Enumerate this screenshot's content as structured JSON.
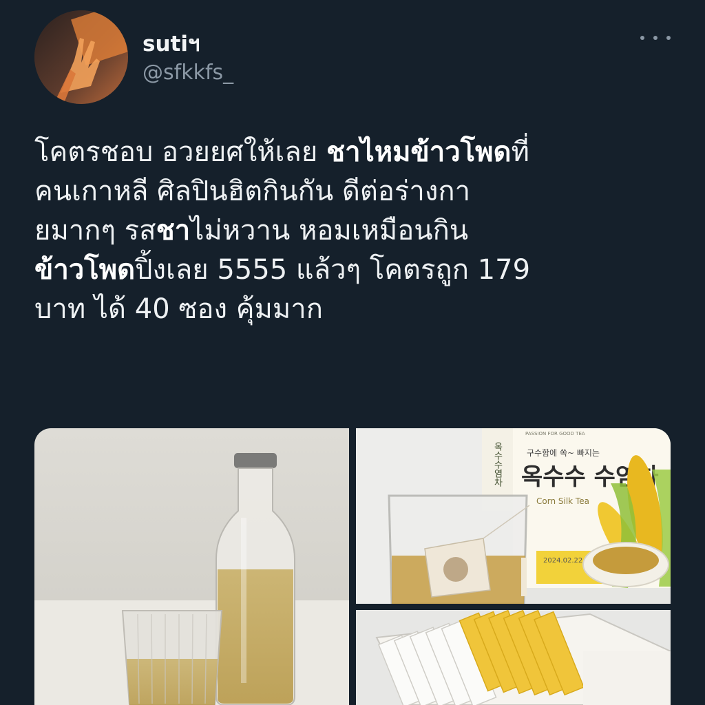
{
  "user": {
    "display_name": "sutiฯ",
    "handle": "@sfkkfs_"
  },
  "menu": {
    "icon": "more-horizontal-icon"
  },
  "tweet": {
    "lines": [
      [
        {
          "text": "โคตรชอบ อวยยศให้เลย ",
          "bold": false
        },
        {
          "text": "ชาไหมข้าวโพด",
          "bold": true
        },
        {
          "text": "ที่",
          "bold": false
        }
      ],
      [
        {
          "text": "คนเกาหลี ศิลปินฮิตกินกัน ดีต่อร่างกา",
          "bold": false
        }
      ],
      [
        {
          "text": "ยมากๆ รส",
          "bold": false
        },
        {
          "text": "ชา",
          "bold": true
        },
        {
          "text": "ไม่หวาน หอมเหมือนกิน",
          "bold": false
        }
      ],
      [
        {
          "text": "ข้าวโพด",
          "bold": true
        },
        {
          "text": "ปิ้งเลย 5555 แล้วๆ โคตรถูก 179",
          "bold": false
        }
      ],
      [
        {
          "text": "บาท ได้ 40 ซอง คุ้มมาก",
          "bold": false
        }
      ]
    ]
  },
  "media": {
    "box_text": {
      "tagline": "PASSION FOR GOOD TEA",
      "subtitle": "구수함에 쏙~ 빠지는",
      "title": "옥수수 수염차",
      "english": "Corn Silk Tea",
      "date": "2024.02.22",
      "side": "옥수수염차"
    },
    "colors": {
      "tea": "#c9a64a",
      "corn": "#e8b820",
      "background": "#15202b"
    }
  }
}
